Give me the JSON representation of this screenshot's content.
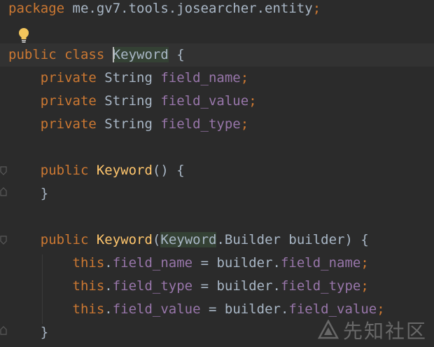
{
  "editor": {
    "lines": [
      {
        "tokens": [
          {
            "t": "package ",
            "c": "kw"
          },
          {
            "t": "me.gv7.tools.josearcher.entity",
            "c": "type"
          },
          {
            "t": ";",
            "c": "semi"
          }
        ]
      },
      {
        "tokens": []
      },
      {
        "tokens": [
          {
            "t": "public ",
            "c": "kw"
          },
          {
            "t": "class ",
            "c": "kw"
          },
          {
            "t": "CARET",
            "c": "caret"
          },
          {
            "t": "Keyword",
            "c": "type hl"
          },
          {
            "t": " {",
            "c": "punct"
          }
        ]
      },
      {
        "tokens": [
          {
            "t": "    private ",
            "c": "kw"
          },
          {
            "t": "String ",
            "c": "type"
          },
          {
            "t": "field_name",
            "c": "field"
          },
          {
            "t": ";",
            "c": "semi"
          }
        ]
      },
      {
        "tokens": [
          {
            "t": "    private ",
            "c": "kw"
          },
          {
            "t": "String ",
            "c": "type"
          },
          {
            "t": "field_value",
            "c": "field"
          },
          {
            "t": ";",
            "c": "semi"
          }
        ]
      },
      {
        "tokens": [
          {
            "t": "    private ",
            "c": "kw"
          },
          {
            "t": "String ",
            "c": "type"
          },
          {
            "t": "field_type",
            "c": "field"
          },
          {
            "t": ";",
            "c": "semi"
          }
        ]
      },
      {
        "tokens": []
      },
      {
        "tokens": [
          {
            "t": "    public ",
            "c": "kw"
          },
          {
            "t": "Keyword",
            "c": "method"
          },
          {
            "t": "() {",
            "c": "punct"
          }
        ]
      },
      {
        "tokens": [
          {
            "t": "    }",
            "c": "punct"
          }
        ]
      },
      {
        "tokens": []
      },
      {
        "tokens": [
          {
            "t": "    public ",
            "c": "kw"
          },
          {
            "t": "Keyword",
            "c": "method"
          },
          {
            "t": "(",
            "c": "punct"
          },
          {
            "t": "Keyword",
            "c": "type hl"
          },
          {
            "t": ".Builder builder) {",
            "c": "punct"
          }
        ]
      },
      {
        "tokens": [
          {
            "t": "        this",
            "c": "kw"
          },
          {
            "t": ".",
            "c": "punct"
          },
          {
            "t": "field_name",
            "c": "field"
          },
          {
            "t": " = builder.",
            "c": "punct"
          },
          {
            "t": "field_name",
            "c": "field"
          },
          {
            "t": ";",
            "c": "semi"
          }
        ]
      },
      {
        "tokens": [
          {
            "t": "        this",
            "c": "kw"
          },
          {
            "t": ".",
            "c": "punct"
          },
          {
            "t": "field_type",
            "c": "field"
          },
          {
            "t": " = builder.",
            "c": "punct"
          },
          {
            "t": "field_type",
            "c": "field"
          },
          {
            "t": ";",
            "c": "semi"
          }
        ]
      },
      {
        "tokens": [
          {
            "t": "        this",
            "c": "kw"
          },
          {
            "t": ".",
            "c": "punct"
          },
          {
            "t": "field_value",
            "c": "field"
          },
          {
            "t": " = builder.",
            "c": "punct"
          },
          {
            "t": "field_value",
            "c": "field"
          },
          {
            "t": ";",
            "c": "semi"
          }
        ]
      },
      {
        "tokens": [
          {
            "t": "    }",
            "c": "punct"
          }
        ]
      }
    ]
  },
  "watermark": {
    "text": "先知社区"
  },
  "colors": {
    "background": "#2b2b2b",
    "keyword": "#cc7832",
    "field": "#9876aa",
    "method": "#ffc66d",
    "text": "#a9b7c6",
    "usage_highlight": "#344134"
  },
  "icons": {
    "intention": "lightbulb-icon",
    "fold": "fold-marker-icon",
    "watermark": "xianzhi-logo-icon"
  }
}
